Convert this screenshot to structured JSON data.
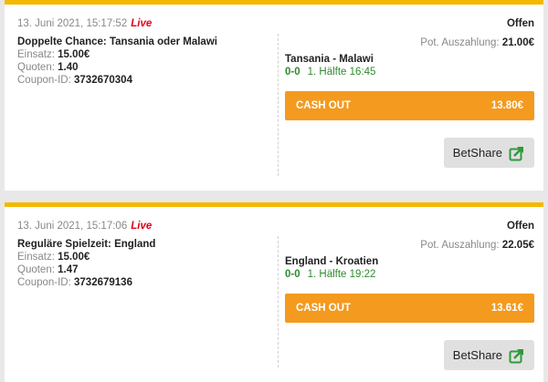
{
  "coupons": [
    {
      "date": "13. Juni 2021, 15:17:52",
      "live": "Live",
      "title": "Doppelte Chance: Tansania oder Malawi",
      "stake_label": "Einsatz:",
      "stake": "15.00€",
      "odds_label": "Quoten:",
      "odds": "1.40",
      "coupon_label": "Coupon-ID:",
      "coupon_id": "3732670304",
      "status": "Offen",
      "payout_label": "Pot. Auszahlung:",
      "payout": "21.00€",
      "match": "Tansania - Malawi",
      "score": "0-0",
      "period": "1. Hälfte 16:45",
      "cashout_label": "CASH OUT",
      "cashout_value": "13.80€",
      "betshare": "BetShare"
    },
    {
      "date": "13. Juni 2021, 15:17:06",
      "live": "Live",
      "title": "Reguläre Spielzeit: England",
      "stake_label": "Einsatz:",
      "stake": "15.00€",
      "odds_label": "Quoten:",
      "odds": "1.47",
      "coupon_label": "Coupon-ID:",
      "coupon_id": "3732679136",
      "status": "Offen",
      "payout_label": "Pot. Auszahlung:",
      "payout": "22.05€",
      "match": "England - Kroatien",
      "score": "0-0",
      "period": "1. Hälfte 19:22",
      "cashout_label": "CASH OUT",
      "cashout_value": "13.61€",
      "betshare": "BetShare"
    }
  ],
  "colors": {
    "accent_bar": "#f5b800",
    "cashout": "#f39a1f",
    "live": "#e2001a",
    "score": "#2e8b2e",
    "share_icon": "#2e9a3a"
  },
  "icons": {
    "share": "share-arrow-icon"
  }
}
